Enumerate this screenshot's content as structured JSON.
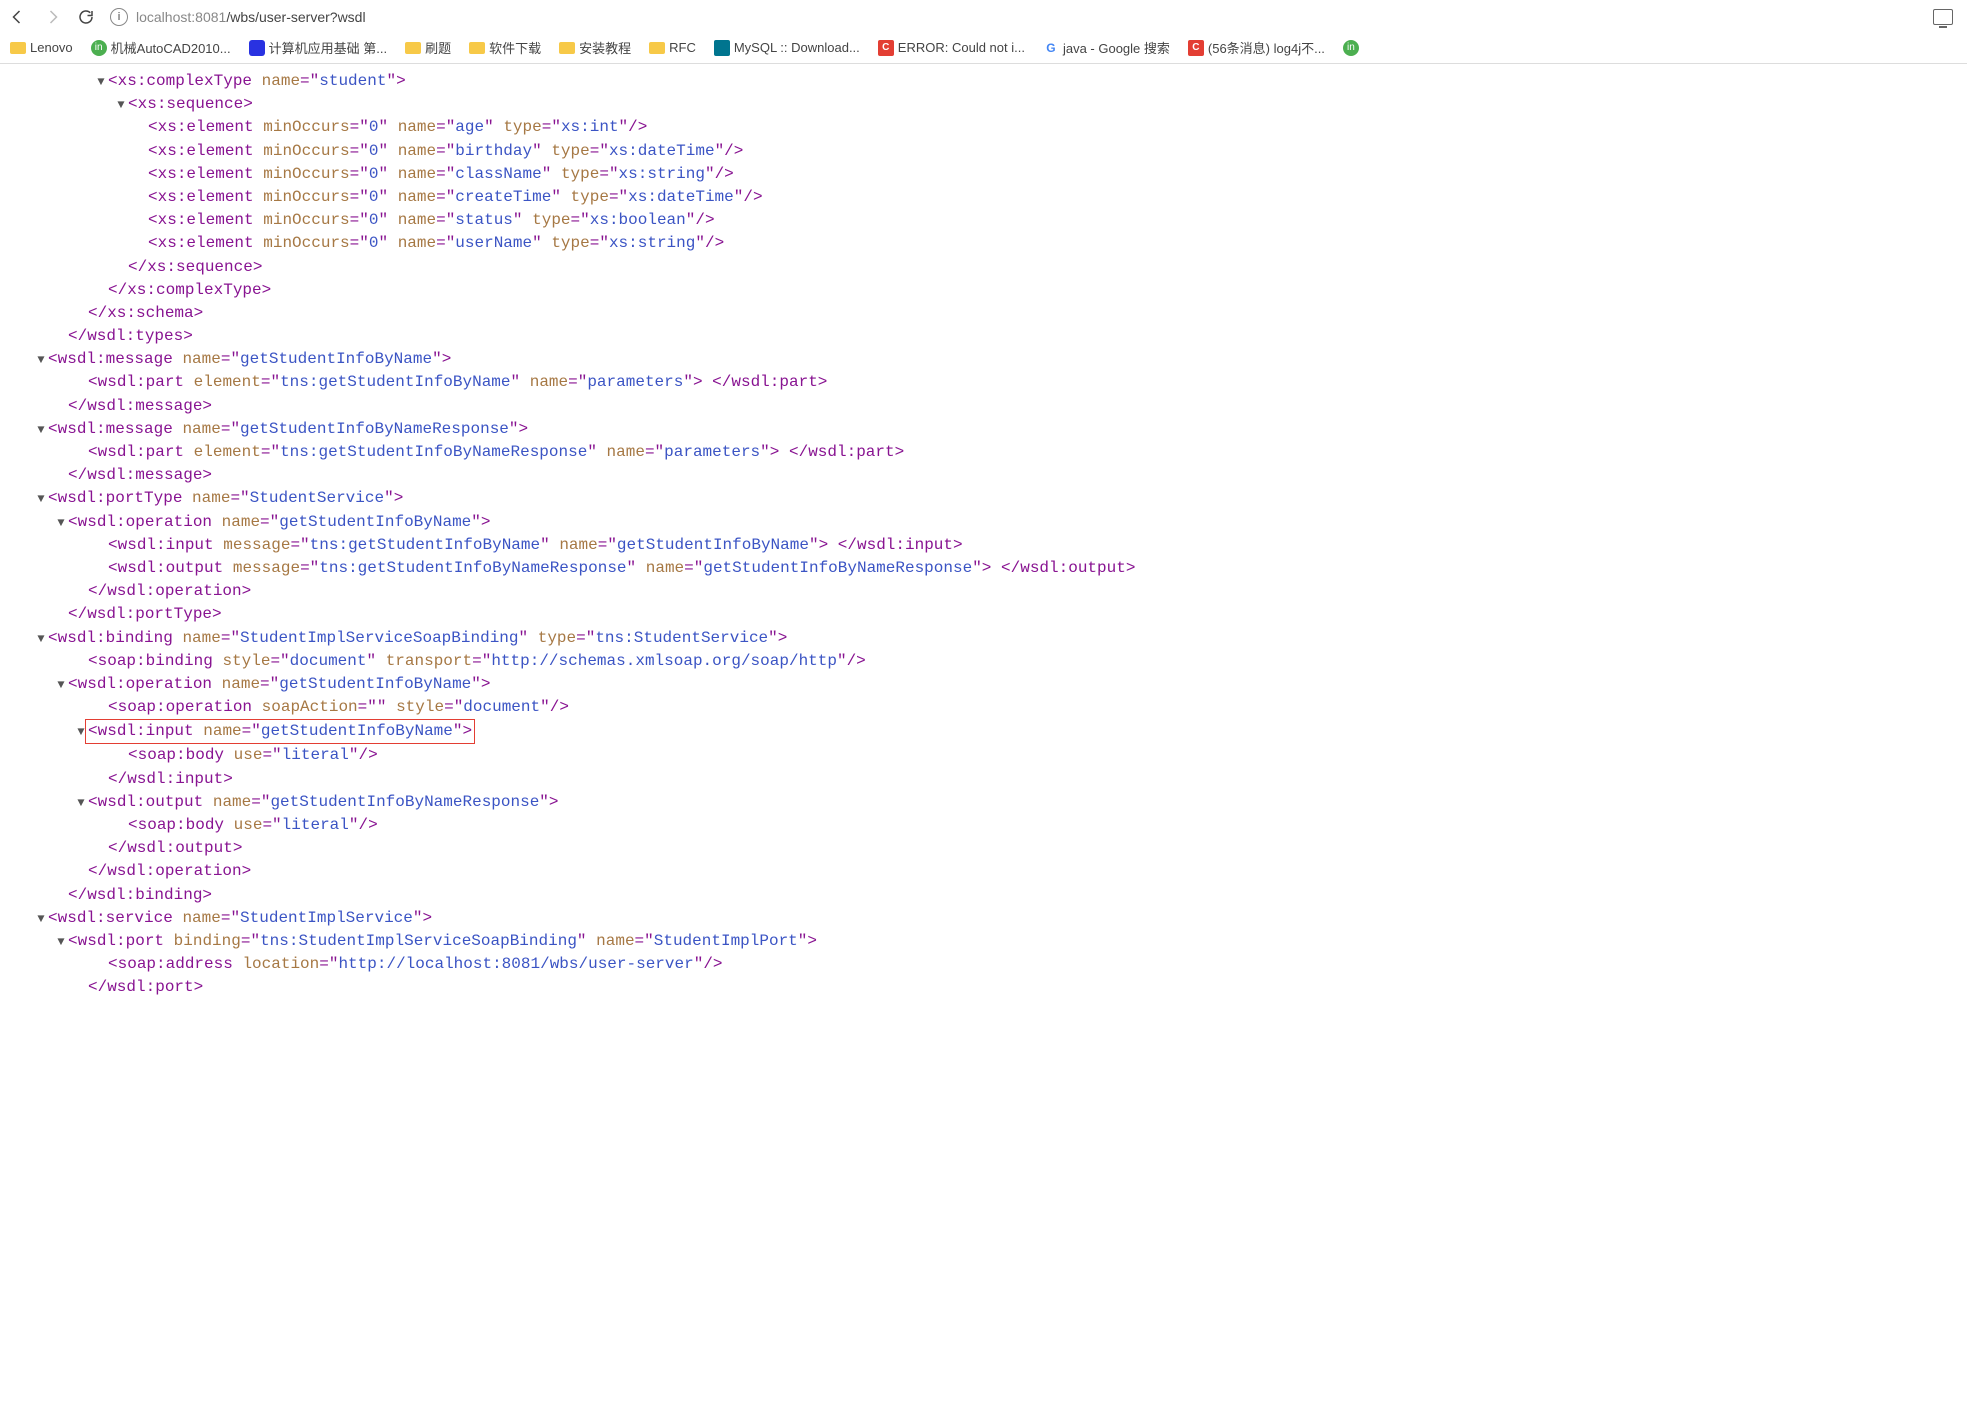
{
  "browser": {
    "url_host": "localhost",
    "url_port": ":8081",
    "url_path": "/wbs/user-server?wsdl"
  },
  "bookmarks": [
    {
      "icon": "folder",
      "label": "Lenovo"
    },
    {
      "icon": "in",
      "label": "机械AutoCAD2010..."
    },
    {
      "icon": "baidu",
      "label": "计算机应用基础 第..."
    },
    {
      "icon": "folder",
      "label": "刷题"
    },
    {
      "icon": "folder",
      "label": "软件下载"
    },
    {
      "icon": "folder",
      "label": "安装教程"
    },
    {
      "icon": "folder",
      "label": "RFC"
    },
    {
      "icon": "mysql",
      "label": "MySQL :: Download..."
    },
    {
      "icon": "csdn",
      "label": "ERROR: Could not i..."
    },
    {
      "icon": "google",
      "label": "java - Google 搜索"
    },
    {
      "icon": "csdn",
      "label": "(56条消息) log4j不..."
    },
    {
      "icon": "in",
      "label": ""
    }
  ],
  "xml": [
    {
      "ind": 4,
      "tw": "▼",
      "open": "<xs:complexType",
      "attrs": [
        [
          "name",
          "student"
        ]
      ],
      "close": ">"
    },
    {
      "ind": 5,
      "tw": "▼",
      "open": "<xs:sequence",
      "attrs": [],
      "close": ">"
    },
    {
      "ind": 6,
      "open": "<xs:element",
      "attrs": [
        [
          "minOccurs",
          "0"
        ],
        [
          "name",
          "age"
        ],
        [
          "type",
          "xs:int"
        ]
      ],
      "close": "/>"
    },
    {
      "ind": 6,
      "open": "<xs:element",
      "attrs": [
        [
          "minOccurs",
          "0"
        ],
        [
          "name",
          "birthday"
        ],
        [
          "type",
          "xs:dateTime"
        ]
      ],
      "close": "/>"
    },
    {
      "ind": 6,
      "open": "<xs:element",
      "attrs": [
        [
          "minOccurs",
          "0"
        ],
        [
          "name",
          "className"
        ],
        [
          "type",
          "xs:string"
        ]
      ],
      "close": "/>"
    },
    {
      "ind": 6,
      "open": "<xs:element",
      "attrs": [
        [
          "minOccurs",
          "0"
        ],
        [
          "name",
          "createTime"
        ],
        [
          "type",
          "xs:dateTime"
        ]
      ],
      "close": "/>"
    },
    {
      "ind": 6,
      "open": "<xs:element",
      "attrs": [
        [
          "minOccurs",
          "0"
        ],
        [
          "name",
          "status"
        ],
        [
          "type",
          "xs:boolean"
        ]
      ],
      "close": "/>"
    },
    {
      "ind": 6,
      "open": "<xs:element",
      "attrs": [
        [
          "minOccurs",
          "0"
        ],
        [
          "name",
          "userName"
        ],
        [
          "type",
          "xs:string"
        ]
      ],
      "close": "/>"
    },
    {
      "ind": 5,
      "closeTag": "xs:sequence"
    },
    {
      "ind": 4,
      "closeTag": "xs:complexType"
    },
    {
      "ind": 3,
      "closeTag": "xs:schema"
    },
    {
      "ind": 2,
      "closeTag": "wsdl:types"
    },
    {
      "ind": 1,
      "tw": "▼",
      "open": "<wsdl:message",
      "attrs": [
        [
          "name",
          "getStudentInfoByName"
        ]
      ],
      "close": ">"
    },
    {
      "ind": 3,
      "open": "<wsdl:part",
      "attrs": [
        [
          "element",
          "tns:getStudentInfoByName"
        ],
        [
          "name",
          "parameters"
        ]
      ],
      "close": ">",
      "inlineClose": "wsdl:part"
    },
    {
      "ind": 2,
      "closeTag": "wsdl:message"
    },
    {
      "ind": 1,
      "tw": "▼",
      "open": "<wsdl:message",
      "attrs": [
        [
          "name",
          "getStudentInfoByNameResponse"
        ]
      ],
      "close": ">"
    },
    {
      "ind": 3,
      "open": "<wsdl:part",
      "attrs": [
        [
          "element",
          "tns:getStudentInfoByNameResponse"
        ],
        [
          "name",
          "parameters"
        ]
      ],
      "close": ">",
      "inlineClose": "wsdl:part"
    },
    {
      "ind": 2,
      "closeTag": "wsdl:message"
    },
    {
      "ind": 1,
      "tw": "▼",
      "open": "<wsdl:portType",
      "attrs": [
        [
          "name",
          "StudentService"
        ]
      ],
      "close": ">"
    },
    {
      "ind": 2,
      "tw": "▼",
      "open": "<wsdl:operation",
      "attrs": [
        [
          "name",
          "getStudentInfoByName"
        ]
      ],
      "close": ">"
    },
    {
      "ind": 4,
      "open": "<wsdl:input",
      "attrs": [
        [
          "message",
          "tns:getStudentInfoByName"
        ],
        [
          "name",
          "getStudentInfoByName"
        ]
      ],
      "close": ">",
      "inlineClose": "wsdl:input"
    },
    {
      "ind": 4,
      "open": "<wsdl:output",
      "attrs": [
        [
          "message",
          "tns:getStudentInfoByNameResponse"
        ],
        [
          "name",
          "getStudentInfoByNameResponse"
        ]
      ],
      "close": ">",
      "inlineClose": "wsdl:output"
    },
    {
      "ind": 3,
      "closeTag": "wsdl:operation"
    },
    {
      "ind": 2,
      "closeTag": "wsdl:portType"
    },
    {
      "ind": 1,
      "tw": "▼",
      "open": "<wsdl:binding",
      "attrs": [
        [
          "name",
          "StudentImplServiceSoapBinding"
        ],
        [
          "type",
          "tns:StudentService"
        ]
      ],
      "close": ">"
    },
    {
      "ind": 3,
      "open": "<soap:binding",
      "attrs": [
        [
          "style",
          "document"
        ],
        [
          "transport",
          "http://schemas.xmlsoap.org/soap/http"
        ]
      ],
      "close": "/>"
    },
    {
      "ind": 2,
      "tw": "▼",
      "open": "<wsdl:operation",
      "attrs": [
        [
          "name",
          "getStudentInfoByName"
        ]
      ],
      "close": ">"
    },
    {
      "ind": 4,
      "open": "<soap:operation",
      "attrs": [
        [
          "soapAction",
          ""
        ],
        [
          "style",
          "document"
        ]
      ],
      "close": "/>"
    },
    {
      "ind": 3,
      "tw": "▼",
      "hl": true,
      "open": "<wsdl:input",
      "attrs": [
        [
          "name",
          "getStudentInfoByName"
        ]
      ],
      "close": ">"
    },
    {
      "ind": 5,
      "open": "<soap:body",
      "attrs": [
        [
          "use",
          "literal"
        ]
      ],
      "close": "/>"
    },
    {
      "ind": 4,
      "closeTag": "wsdl:input"
    },
    {
      "ind": 3,
      "tw": "▼",
      "open": "<wsdl:output",
      "attrs": [
        [
          "name",
          "getStudentInfoByNameResponse"
        ]
      ],
      "close": ">"
    },
    {
      "ind": 5,
      "open": "<soap:body",
      "attrs": [
        [
          "use",
          "literal"
        ]
      ],
      "close": "/>"
    },
    {
      "ind": 4,
      "closeTag": "wsdl:output"
    },
    {
      "ind": 3,
      "closeTag": "wsdl:operation"
    },
    {
      "ind": 2,
      "closeTag": "wsdl:binding"
    },
    {
      "ind": 1,
      "tw": "▼",
      "open": "<wsdl:service",
      "attrs": [
        [
          "name",
          "StudentImplService"
        ]
      ],
      "close": ">"
    },
    {
      "ind": 2,
      "tw": "▼",
      "open": "<wsdl:port",
      "attrs": [
        [
          "binding",
          "tns:StudentImplServiceSoapBinding"
        ],
        [
          "name",
          "StudentImplPort"
        ]
      ],
      "close": ">"
    },
    {
      "ind": 4,
      "open": "<soap:address",
      "attrs": [
        [
          "location",
          "http://localhost:8081/wbs/user-server"
        ]
      ],
      "close": "/>"
    },
    {
      "ind": 3,
      "closeTag": "wsdl:port"
    }
  ]
}
